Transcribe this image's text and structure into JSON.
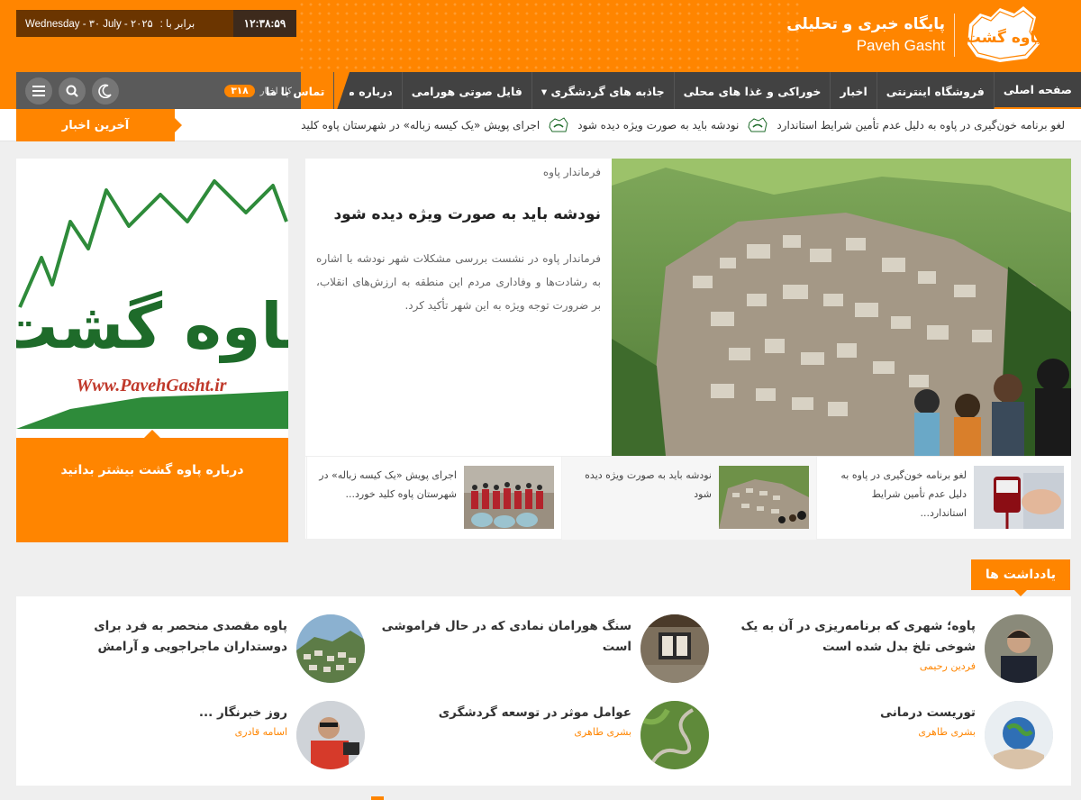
{
  "header": {
    "clock": "۱۲:۳۸:۵۹",
    "date_fa_label": "برابر با :",
    "date_text": "Wednesday - ۳۰ July - ۲۰۲۵",
    "site_title_fa": "پایگاه خبری و تحلیلی",
    "site_title_en": "Paveh Gasht",
    "logo_text": "پاوه گشت"
  },
  "nav": {
    "items": [
      {
        "label": "صفحه اصلی"
      },
      {
        "label": "فروشگاه اینترنتی"
      },
      {
        "label": "اخبار"
      },
      {
        "label": "خوراکی و غذا های محلی"
      },
      {
        "label": "جاذبه های گردشگری ▾"
      },
      {
        "label": "فایل صوتی هورامی"
      },
      {
        "label": "درباره ما"
      },
      {
        "label": "تماس با ما"
      }
    ],
    "news_count_label": "کل اخبار",
    "news_count": "۳۱۸",
    "icons": [
      "menu-icon",
      "search-icon",
      "moon-icon"
    ]
  },
  "ticker": {
    "title": "آخرین اخبار",
    "items": [
      "لغو برنامه خون‌گیری در پاوه به دلیل عدم تأمین شرایط استاندارد",
      "نودشه باید به صورت ویژه دیده شود",
      "اجرای پویش «یک کیسه زباله» در شهرستان پاوه کلید"
    ]
  },
  "sidebar": {
    "logo_text": "پاوه گشت",
    "logo_url": "Www.PavehGasht.ir",
    "cta": "درباره پاوه گشت بیشتر بدانید"
  },
  "featured": {
    "category": "فرماندار پاوه",
    "title": "نودشه باید به صورت ویژه دیده شود",
    "excerpt": "فرماندار پاوه در نشست بررسی مشکلات شهر نودشه با اشاره به رشادت‌ها و وفاداری مردم این منطقه به ارزش‌های انقلاب، بر ضرورت توجه ویژه به این شهر تأکید کرد."
  },
  "subnews": [
    {
      "text": "لغو برنامه خون‌گیری در پاوه به دلیل عدم تأمین شرایط استاندارد..."
    },
    {
      "text": "نودشه باید به صورت ویژه دیده شود"
    },
    {
      "text": "اجرای پویش «یک کیسه زباله» در شهرستان پاوه کلید خورد..."
    }
  ],
  "notes": {
    "heading": "یادداشت ها",
    "items": [
      {
        "title": "پاوه؛ شهری که برنامه‌ریزی در آن به یک شوخی تلخ بدل شده است",
        "author": "فردین رحیمی"
      },
      {
        "title": "سنگ هورامان نمادی که در حال فراموشی است",
        "author": ""
      },
      {
        "title": "پاوه مقصدی منحصر به فرد برای دوستداران ماجراجویی و آرامش",
        "author": ""
      },
      {
        "title": "توریست درمانی",
        "author": "بشری طاهری"
      },
      {
        "title": "عوامل موثر در توسعه گردشگری",
        "author": "بشری طاهری"
      },
      {
        "title": "روز خبرنگار ...",
        "author": "اسامه قادری"
      }
    ]
  },
  "colors": {
    "accent": "#ff8500",
    "dark_nav": "#424242",
    "brand_green": "#1e6b2a"
  }
}
